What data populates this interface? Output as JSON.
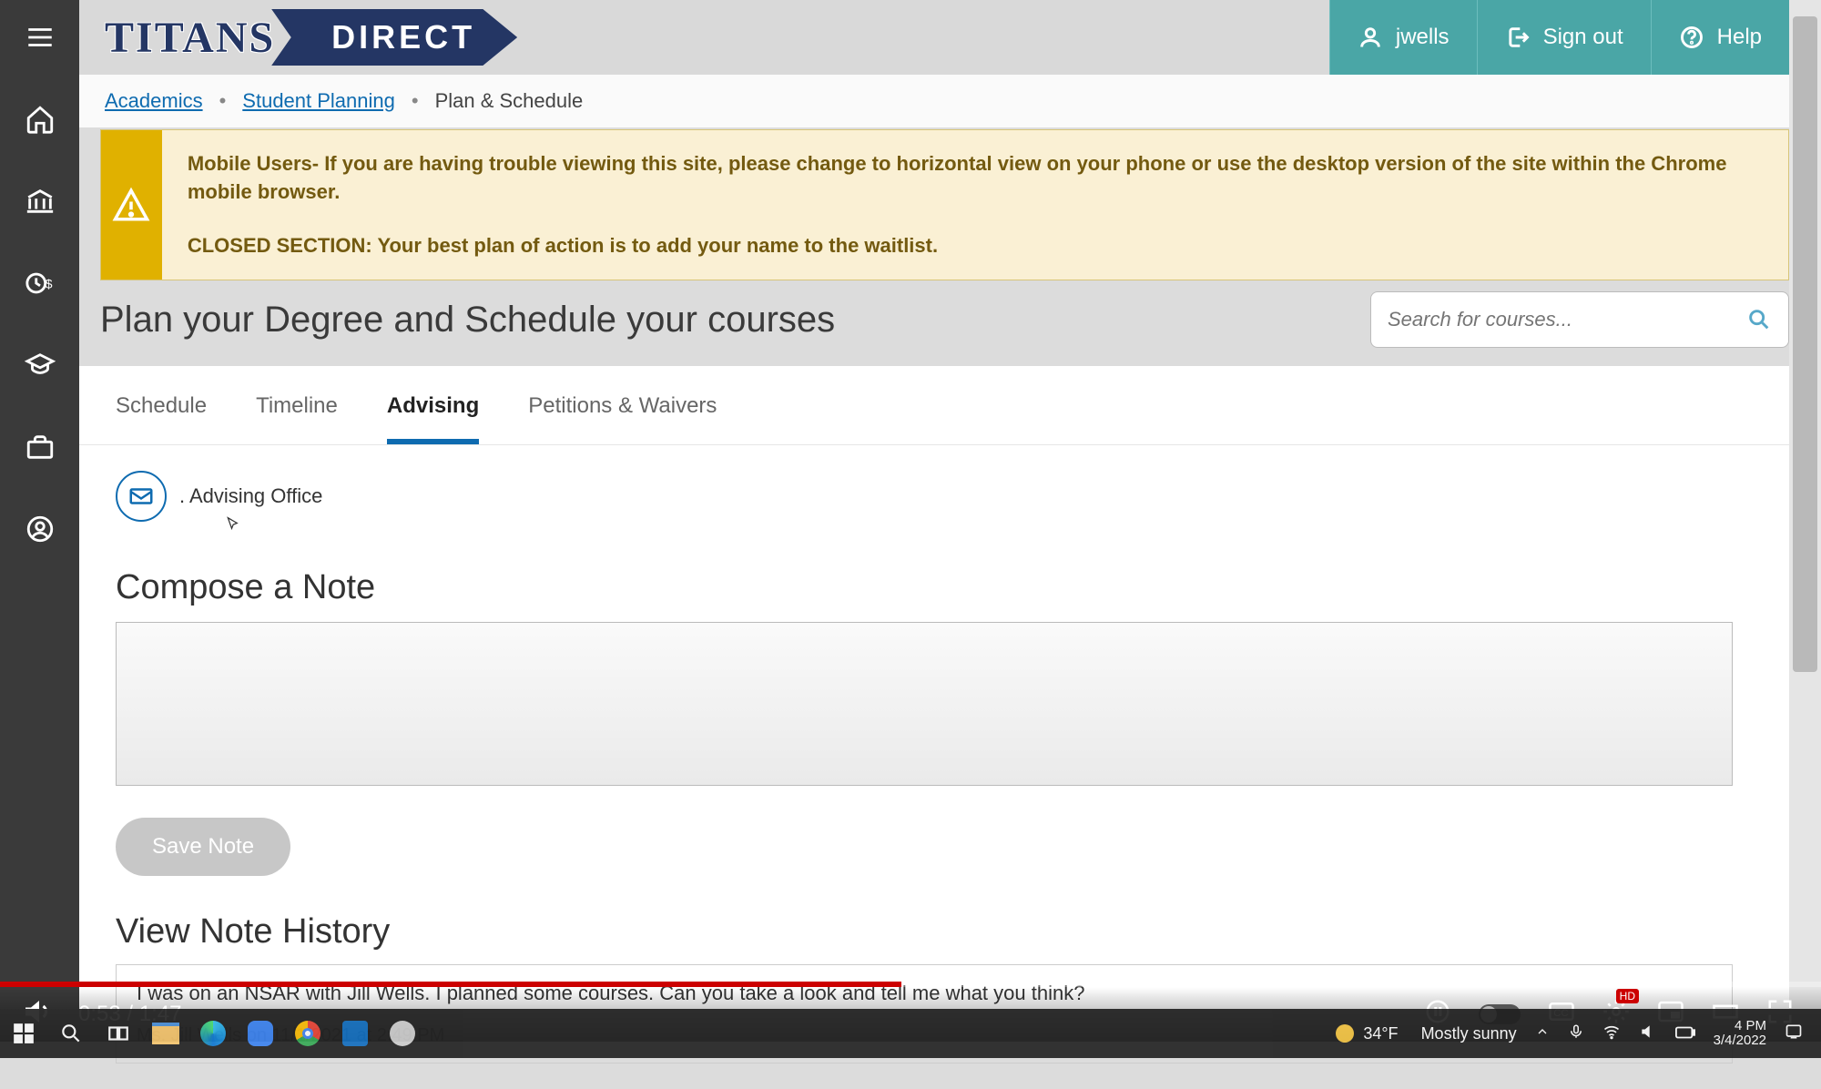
{
  "logo": {
    "left": "TITANS",
    "right": "DIRECT"
  },
  "topbar": {
    "user": "jwells",
    "signout": "Sign out",
    "help": "Help"
  },
  "breadcrumbs": {
    "link1": "Academics",
    "link2": "Student Planning",
    "current": "Plan & Schedule"
  },
  "alert": {
    "line1": "Mobile Users- If you are having trouble viewing this site, please change to horizontal view on your phone or use the desktop version of the site within the Chrome mobile browser.",
    "line2": "CLOSED SECTION: Your best plan of action is to add your name to the waitlist."
  },
  "page_title": "Plan your Degree and Schedule your courses",
  "search": {
    "placeholder": "Search for courses..."
  },
  "tabs": {
    "t1": "Schedule",
    "t2": "Timeline",
    "t3": "Advising",
    "t4": "Petitions & Waivers"
  },
  "advising": {
    "advisor_label": ". Advising Office",
    "compose_heading": "Compose a Note",
    "note_value": "",
    "save_label": "Save Note",
    "history_heading": "View Note History",
    "history_note": {
      "text": "I was on an NSAR with Jill Wells. I planned some courses. Can you take a look and tell me what you think?",
      "meta": "Ms. Jill Wells on 11/1/2021 at 2:49 PM"
    }
  },
  "video": {
    "current_time": "0:53",
    "duration": "1:47",
    "hd": "HD"
  },
  "taskbar": {
    "temp": "34°F",
    "weather": "Mostly sunny",
    "time": "4 PM",
    "date": "3/4/2022"
  }
}
